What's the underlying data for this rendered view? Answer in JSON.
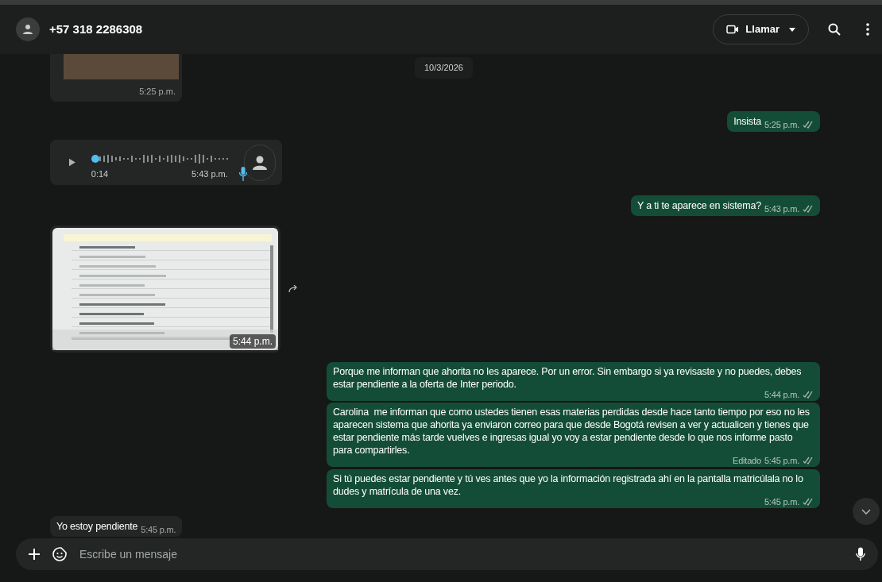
{
  "header": {
    "contact": "+57 318 2286308",
    "call_button": "Llamar"
  },
  "date_chip": "10/3/2026",
  "messages": [
    {
      "kind": "image",
      "outgoing": false,
      "time": "5:25 p.m."
    },
    {
      "kind": "text",
      "outgoing": true,
      "text": "Insista",
      "time": "5:25 p.m.",
      "read": false
    },
    {
      "kind": "voice",
      "outgoing": false,
      "duration": "0:14",
      "time": "5:43 p.m."
    },
    {
      "kind": "text",
      "outgoing": true,
      "text": "Y a ti te aparece en sistema?",
      "time": "5:43 p.m.",
      "read": false
    },
    {
      "kind": "screenshot",
      "outgoing": false,
      "time": "5:44 p.m.",
      "forward": true
    },
    {
      "kind": "text",
      "outgoing": true,
      "text": "Porque me informan que ahorita no les aparece. Por un error. Sin embargo si ya revisaste y no puedes, debes estar pendiente a la oferta de Inter periodo.",
      "time": "5:44 p.m.",
      "read": false
    },
    {
      "kind": "text",
      "outgoing": true,
      "text": "Carolina  me informan que como ustedes tienen esas materias perdidas desde hace tanto tiempo por eso no les aparecen sistema que ahorita ya enviaron correo para que desde Bogotá revisen a ver y actualicen y tienes que estar pendiente más tarde vuelves e ingresas igual yo voy a estar pendiente desde lo que nos informe pasto para compartirles.",
      "edited": "Editado",
      "time": "5:45 p.m.",
      "read": false
    },
    {
      "kind": "text",
      "outgoing": true,
      "text": "Si tú puedes estar pendiente y tú ves antes que yo la información registrada ahí en la pantalla matricúlala no lo dudes y matrícula de una vez.",
      "time": "5:45 p.m.",
      "read": false
    },
    {
      "kind": "text",
      "outgoing": false,
      "text": "Yo estoy pendiente",
      "time": "5:45 p.m."
    }
  ],
  "composer": {
    "placeholder": "Escribe un mensaje"
  }
}
